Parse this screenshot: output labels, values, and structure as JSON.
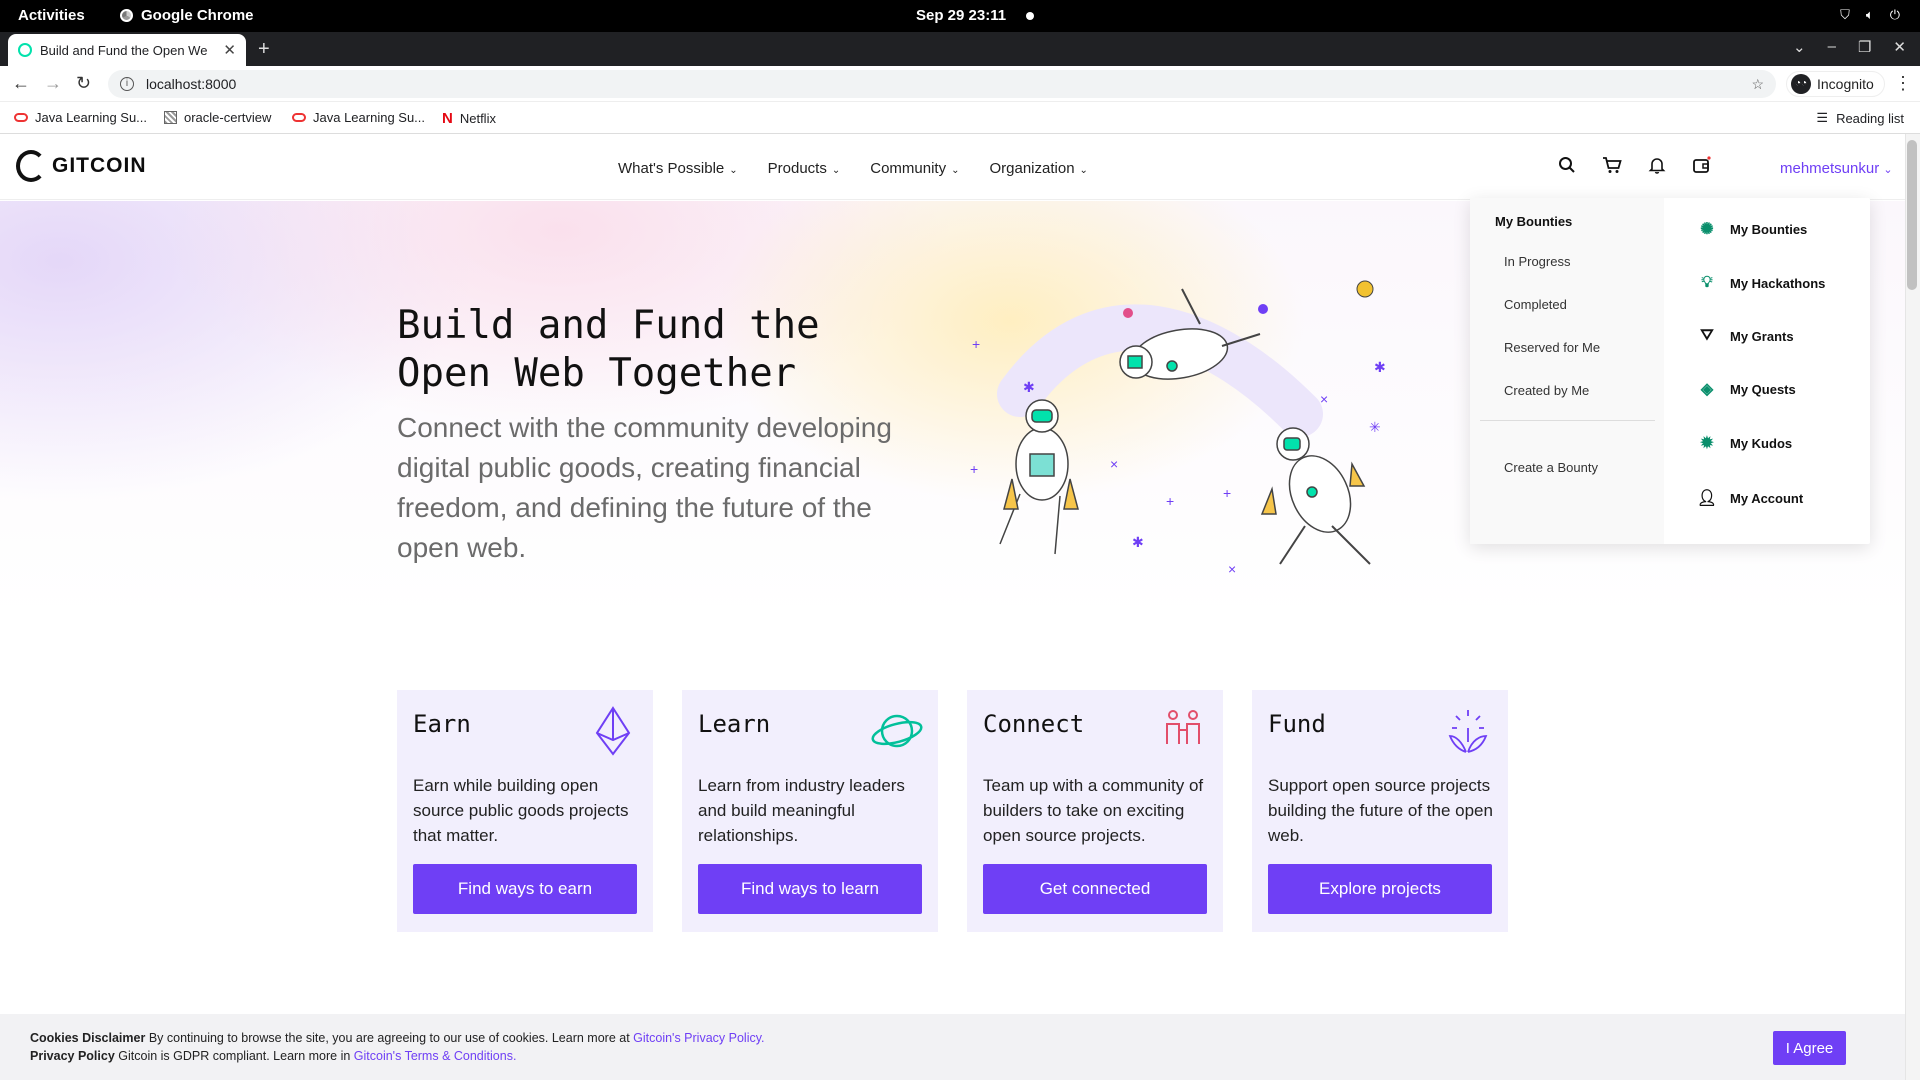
{
  "gnome": {
    "activities": "Activities",
    "app": "Google Chrome",
    "clock": "Sep 29  23:11"
  },
  "browser": {
    "tab_title": "Build and Fund the Open We",
    "url": "localhost:8000",
    "incognito": "Incognito",
    "bookmarks": [
      "Java Learning Su...",
      "oracle-certview",
      "Java Learning Su...",
      "Netflix"
    ],
    "reading_list": "Reading list"
  },
  "site": {
    "logo": "GITCOIN",
    "nav": [
      "What's Possible",
      "Products",
      "Community",
      "Organization"
    ],
    "username": "mehmetsunkur",
    "hero_title": "Build and Fund the Open Web Together",
    "hero_lead": "Connect with the community developing digital public goods, creating financial freedom, and defining the future of the open web."
  },
  "dropdown": {
    "left_heading": "My Bounties",
    "left_items": [
      "In Progress",
      "Completed",
      "Reserved for Me",
      "Created by Me"
    ],
    "create": "Create a Bounty",
    "right_items": [
      {
        "label": "My Bounties",
        "icon": "bounty-icon"
      },
      {
        "label": "My Hackathons",
        "icon": "hackathon-icon"
      },
      {
        "label": "My Grants",
        "icon": "grants-icon"
      },
      {
        "label": "My Quests",
        "icon": "quests-icon"
      },
      {
        "label": "My Kudos",
        "icon": "kudos-icon"
      },
      {
        "label": "My Account",
        "icon": "account-icon"
      }
    ]
  },
  "cards": [
    {
      "title": "Earn",
      "desc": "Earn while building open source public goods projects that matter.",
      "button": "Find ways to earn",
      "icon": "ethereum-icon"
    },
    {
      "title": "Learn",
      "desc": "Learn from industry leaders and build meaningful relationships.",
      "button": "Find ways to learn",
      "icon": "planet-icon"
    },
    {
      "title": "Connect",
      "desc": "Team up with a community of builders to take on exciting open source projects.",
      "button": "Get connected",
      "icon": "people-icon"
    },
    {
      "title": "Fund",
      "desc": "Support open source projects building the future of the open web.",
      "button": "Explore projects",
      "icon": "sprout-icon"
    }
  ],
  "cookie": {
    "disclaimer_label": "Cookies Disclaimer",
    "disclaimer_text": "By continuing to browse the site, you are agreeing to our use of cookies. Learn more at",
    "privacy_link": "Gitcoin's Privacy Policy.",
    "policy_label": "Privacy Policy",
    "policy_text": "Gitcoin is GDPR compliant. Learn more in",
    "terms_link": "Gitcoin's Terms & Conditions.",
    "agree": "I Agree"
  },
  "colors": {
    "accent": "#6f3ff5",
    "card_bg": "#f2effd",
    "teal": "#02e2ac"
  }
}
